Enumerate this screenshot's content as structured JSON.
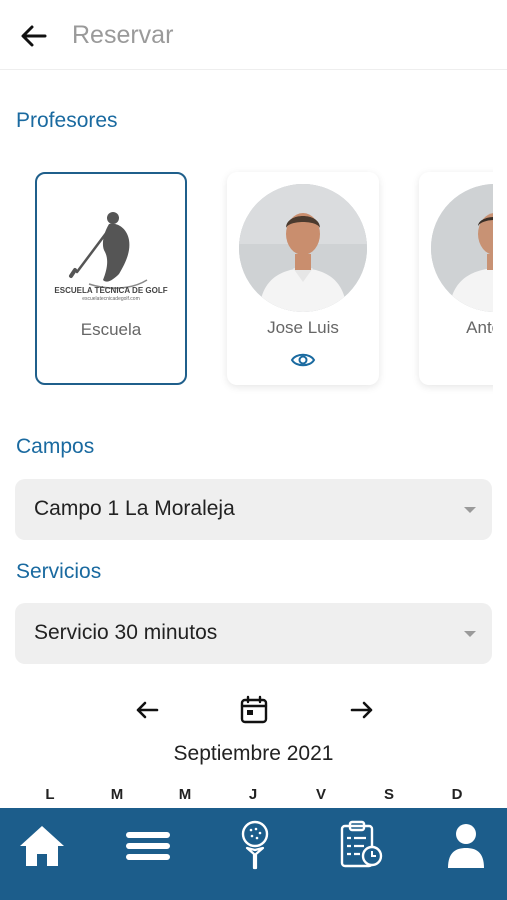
{
  "header": {
    "title": "Reservar",
    "back_icon": "arrow-left-icon"
  },
  "profesores": {
    "title": "Profesores",
    "cards": [
      {
        "name": "Escuela",
        "logo_text": "ESCUELA TÉCNICA DE GOLF",
        "logo_subtext": "escuelatecnicadegolf.com",
        "selected": true
      },
      {
        "name": "Jose Luis",
        "selected": false
      },
      {
        "name": "Antonio",
        "selected": false
      }
    ]
  },
  "campos": {
    "title": "Campos",
    "value": "Campo 1 La Moraleja"
  },
  "servicios": {
    "title": "Servicios",
    "value": "Servicio 30 minutos"
  },
  "calendar": {
    "month": "Septiembre 2021",
    "weekdays": [
      "L",
      "M",
      "M",
      "J",
      "V",
      "S",
      "D"
    ]
  },
  "tabbar": {
    "accent": "#1c5d8b",
    "items": [
      "home-icon",
      "menu-icon",
      "golf-ball-icon",
      "bookings-clipboard-icon",
      "user-icon"
    ]
  },
  "colors": {
    "accent": "#1a6aa0",
    "selected_border": "#1f5f8b"
  }
}
